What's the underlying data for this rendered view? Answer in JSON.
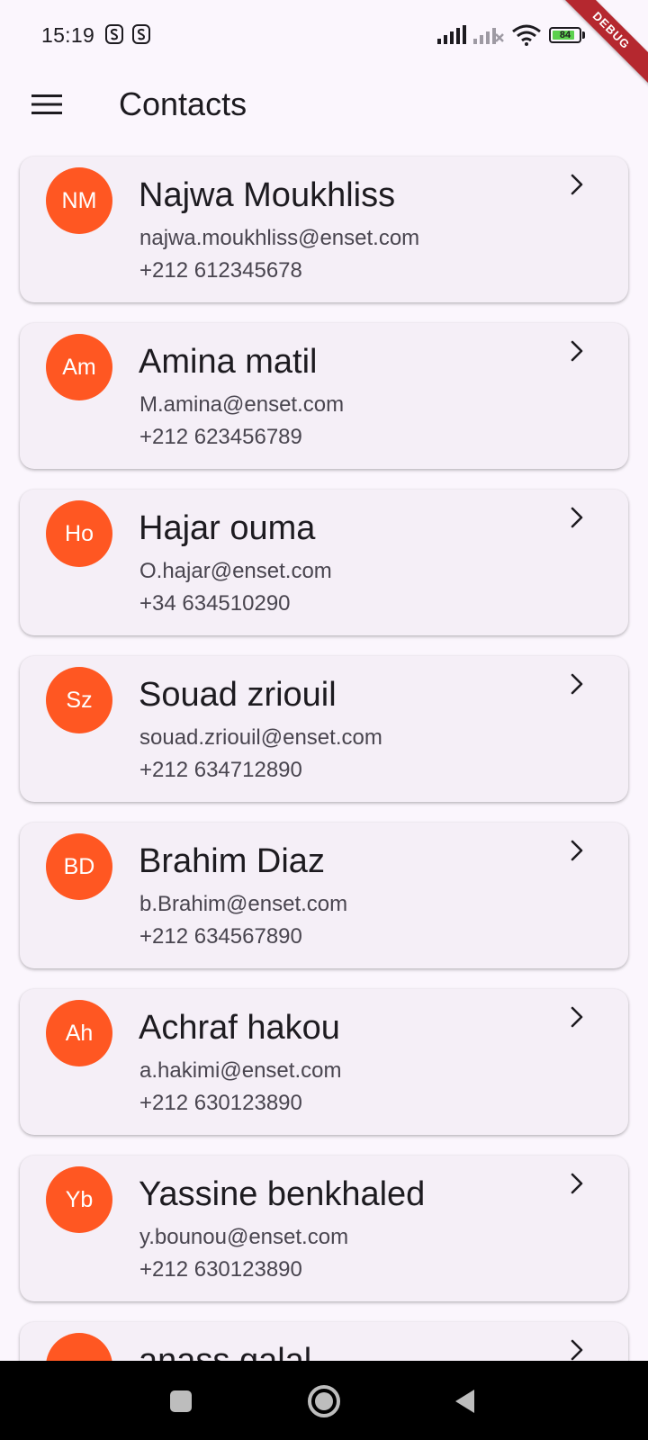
{
  "status_bar": {
    "time": "15:19",
    "battery_level": "84",
    "battery_fraction": 0.84,
    "icons": [
      "app-s-icon",
      "app-s-icon",
      "signal-icon",
      "signal-off-icon",
      "wifi-icon",
      "battery-icon"
    ]
  },
  "debug_banner": "DEBUG",
  "app_bar": {
    "title": "Contacts",
    "menu_icon": "menu-icon"
  },
  "colors": {
    "avatar_bg": "#ff5722",
    "card_bg": "#f5eff7",
    "page_bg": "#fbf6fd",
    "debug_banner": "#b5282f"
  },
  "contacts": [
    {
      "initials": "NM",
      "name": "Najwa Moukhliss",
      "email": "najwa.moukhliss@enset.com",
      "phone": "+212 612345678"
    },
    {
      "initials": "Am",
      "name": "Amina matil",
      "email": "M.amina@enset.com",
      "phone": "+212 623456789"
    },
    {
      "initials": "Ho",
      "name": "Hajar ouma",
      "email": "O.hajar@enset.com",
      "phone": "+34 634510290"
    },
    {
      "initials": "Sz",
      "name": "Souad zriouil",
      "email": "souad.zriouil@enset.com",
      "phone": "+212 634712890"
    },
    {
      "initials": "BD",
      "name": "Brahim Diaz",
      "email": "b.Brahim@enset.com",
      "phone": "+212 634567890"
    },
    {
      "initials": "Ah",
      "name": "Achraf hakou",
      "email": "a.hakimi@enset.com",
      "phone": "+212 630123890"
    },
    {
      "initials": "Yb",
      "name": "Yassine benkhaled",
      "email": "y.bounou@enset.com",
      "phone": "+212 630123890"
    },
    {
      "initials": "",
      "name": "anass galal",
      "email": "",
      "phone": ""
    }
  ],
  "nav_bar": {
    "buttons": [
      "recents-icon",
      "home-icon",
      "back-icon"
    ]
  }
}
